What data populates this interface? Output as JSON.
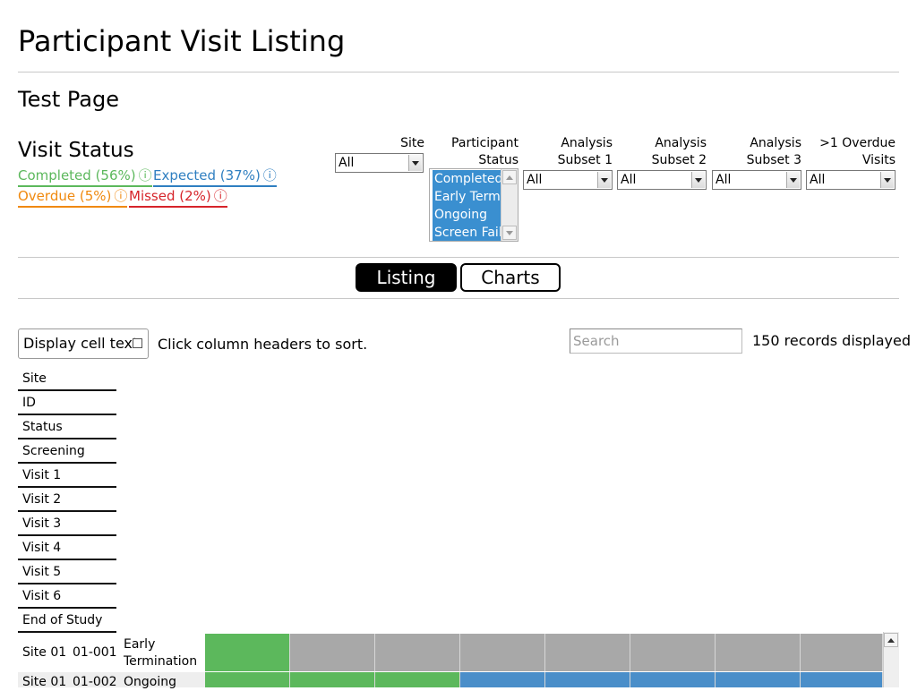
{
  "page": {
    "title": "Participant Visit Listing",
    "subtitle": "Test Page"
  },
  "visit_status": {
    "heading": "Visit Status",
    "legend": [
      {
        "label": "Completed (56%)",
        "color": "#5cb85c",
        "icon": "info-icon"
      },
      {
        "label": "Expected (37%)",
        "color": "#2f7fc1",
        "icon": "info-icon"
      },
      {
        "label": "Overdue (5%)",
        "color": "#f0890e",
        "icon": "info-icon"
      },
      {
        "label": "Missed (2%)",
        "color": "#d6242a",
        "icon": "info-icon"
      }
    ],
    "info_glyph": "ⓘ"
  },
  "filters": {
    "site": {
      "label": "Site",
      "value": "All"
    },
    "participant_status": {
      "label_line1": "Participant",
      "label_line2": "Status",
      "options": [
        "Completed",
        "Early Termination",
        "Ongoing",
        "Screen Failure"
      ],
      "selected": [
        "Completed",
        "Early Termination",
        "Ongoing",
        "Screen Failure"
      ]
    },
    "analysis_subset_1": {
      "label_line1": "Analysis",
      "label_line2": "Subset 1",
      "value": "All"
    },
    "analysis_subset_2": {
      "label_line1": "Analysis",
      "label_line2": "Subset 2",
      "value": "All"
    },
    "analysis_subset_3": {
      "label_line1": "Analysis",
      "label_line2": "Subset 3",
      "value": "All"
    },
    "overdue_visits": {
      "label_line1": ">1 Overdue",
      "label_line2": "Visits",
      "value": "All"
    }
  },
  "tabs": [
    {
      "label": "Listing",
      "active": true
    },
    {
      "label": "Charts",
      "active": false
    }
  ],
  "controls": {
    "display_cell_text_label": "Display cell text",
    "display_cell_text_checked": false,
    "sort_hint": "Click column headers to sort.",
    "search_placeholder": "Search",
    "search_value": "",
    "records_displayed": "150 records displayed"
  },
  "colors": {
    "completed": "#5cb85c",
    "expected": "#4a8ec9",
    "not_applicable": "#a8a8a8"
  },
  "table": {
    "columns": [
      "Site",
      "ID",
      "Status",
      "Screening",
      "Visit 1",
      "Visit 2",
      "Visit 3",
      "Visit 4",
      "Visit 5",
      "Visit 6",
      "End of Study"
    ],
    "rows": [
      {
        "site": "Site 01",
        "id": "01-001",
        "status_line1": "Early",
        "status_line2": "Termination",
        "visits": [
          "completed",
          "na",
          "na",
          "na",
          "na",
          "na",
          "na",
          "na"
        ]
      },
      {
        "site": "Site 01",
        "id": "01-002",
        "status_line1": "Ongoing",
        "status_line2": "",
        "visits": [
          "completed",
          "completed",
          "completed",
          "expected",
          "expected",
          "expected",
          "expected",
          "expected"
        ]
      }
    ]
  }
}
